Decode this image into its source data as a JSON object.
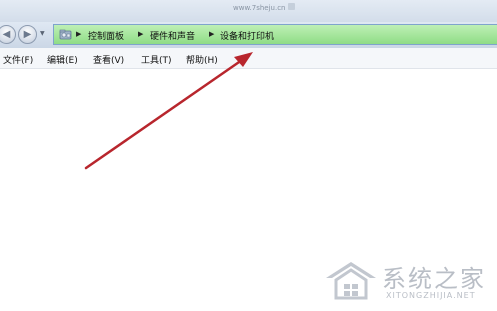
{
  "window": {
    "title_text": "www.7sheju.cn"
  },
  "address_bar": {
    "breadcrumbs": [
      "控制面板",
      "硬件和声音",
      "设备和打印机"
    ],
    "separator": "▶",
    "folder_icon": "control-panel-folder-icon",
    "highlight_color": "#a6e79c"
  },
  "navigation": {
    "back_glyph": "◀",
    "forward_glyph": "▶",
    "history_glyph": "▼"
  },
  "menu": {
    "items": [
      "文件(F)",
      "编辑(E)",
      "查看(V)",
      "工具(T)",
      "帮助(H)"
    ]
  },
  "annotation": {
    "color": "#b8262d"
  },
  "watermark": {
    "name": "系统之家",
    "url": "XITONGZHIJIA.NET"
  }
}
